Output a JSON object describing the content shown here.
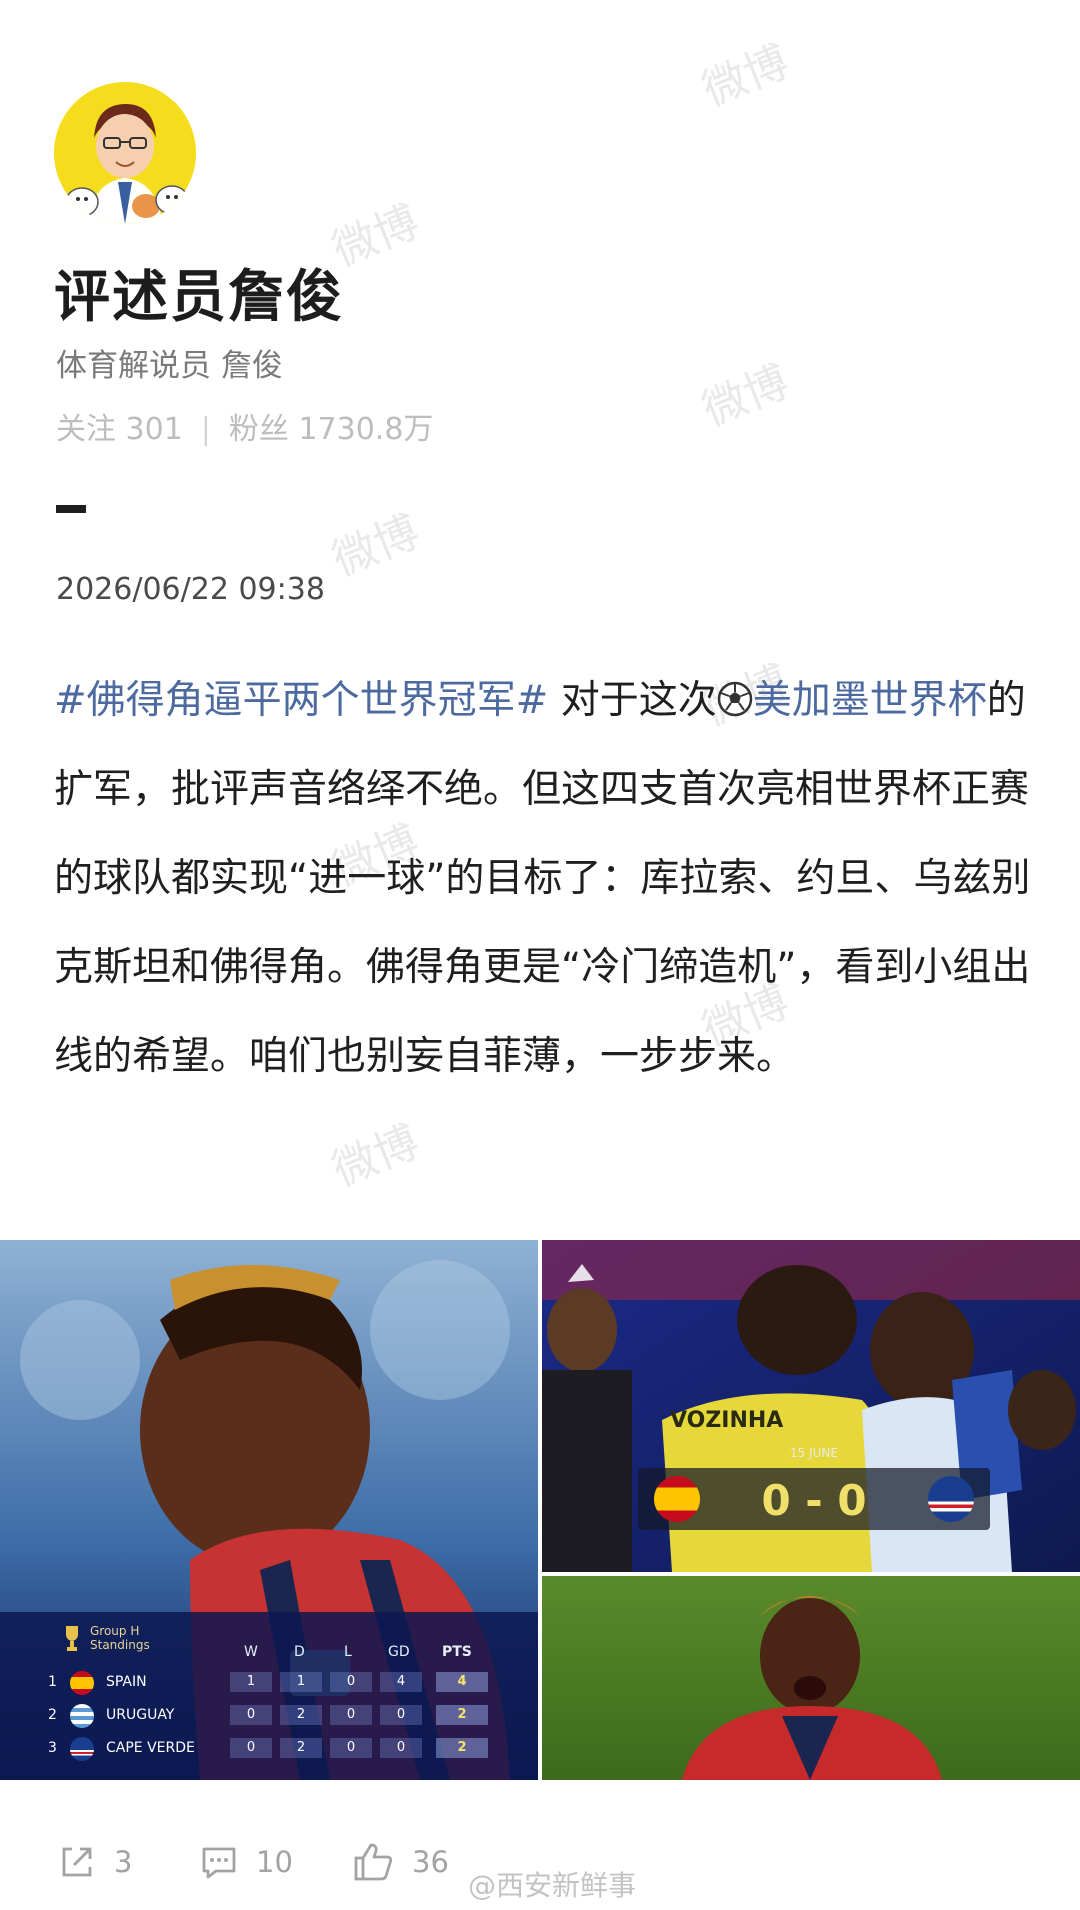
{
  "profile": {
    "name": "评述员詹俊",
    "bio": "体育解说员 詹俊",
    "following_label": "关注 301",
    "fans_label": "粉丝 1730.8万"
  },
  "post": {
    "timestamp": "2026/06/22 09:38",
    "hashtag": "#佛得角逼平两个世界冠军#",
    "text1": " 对于这次",
    "link": "美加墨世界杯",
    "text2": "的扩军，批评声音络绎不绝。但这四支首次亮相世界杯正赛的球队都实现“进一球”的目标了：库拉索、约旦、乌兹别克斯坦和佛得角。佛得角更是“冷门缔造机”，看到小组出线的希望。咱们也别妄自菲薄，一步步来。"
  },
  "images": {
    "standings": {
      "title_line1": "Group H",
      "title_line2": "Standings",
      "headers": [
        "W",
        "D",
        "L",
        "GD",
        "PTS"
      ],
      "rows": [
        {
          "pos": "1",
          "team": "SPAIN",
          "w": "1",
          "d": "1",
          "l": "0",
          "gd": "4",
          "pts": "4"
        },
        {
          "pos": "2",
          "team": "URUGUAY",
          "w": "0",
          "d": "2",
          "l": "0",
          "gd": "0",
          "pts": "2"
        },
        {
          "pos": "3",
          "team": "CAPE VERDE",
          "w": "0",
          "d": "2",
          "l": "0",
          "gd": "0",
          "pts": "2"
        }
      ]
    },
    "match": {
      "date": "15 JUNE",
      "score": "0 - 0",
      "jersey_name": "VOZINHA"
    }
  },
  "actions": {
    "share_count": "3",
    "comment_count": "10",
    "like_count": "36"
  },
  "source_watermark": "@西安新鲜事",
  "watermark_text": "微博",
  "colors": {
    "link": "#4d6aa0",
    "avatar_bg": "#f5dd1d",
    "muted": "#bdbdbd"
  }
}
